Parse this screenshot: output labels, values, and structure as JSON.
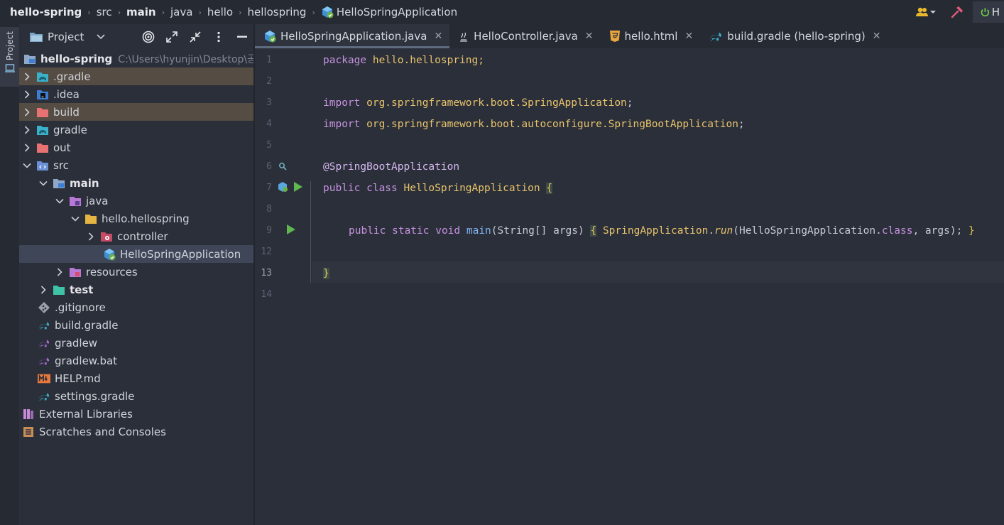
{
  "breadcrumb": [
    {
      "label": "hello-spring",
      "bold": true
    },
    {
      "label": "src",
      "bold": false
    },
    {
      "label": "main",
      "bold": true
    },
    {
      "label": "java",
      "bold": false
    },
    {
      "label": "hello",
      "bold": false
    },
    {
      "label": "hellospring",
      "bold": false
    },
    {
      "label": "HelloSpringApplication",
      "bold": false
    }
  ],
  "run_config_label": "H",
  "strip": {
    "project_label": "Project"
  },
  "project_panel": {
    "title": "Project",
    "root_label": "hello-spring",
    "root_path": "C:\\Users\\hyunjin\\Desktop\\공",
    "tree": [
      {
        "label": ".gradle",
        "level": 0,
        "chevron": "right",
        "icon": "gradle-folder",
        "highlight": true
      },
      {
        "label": ".idea",
        "level": 0,
        "chevron": "right",
        "icon": "idea-folder",
        "highlight": false
      },
      {
        "label": "build",
        "level": 0,
        "chevron": "right",
        "icon": "build-folder",
        "highlight": true
      },
      {
        "label": "gradle",
        "level": 0,
        "chevron": "right",
        "icon": "gradle-folder",
        "highlight": false
      },
      {
        "label": "out",
        "level": 0,
        "chevron": "right",
        "icon": "excluded-folder",
        "highlight": false
      },
      {
        "label": "src",
        "level": 0,
        "chevron": "down",
        "icon": "source-folder",
        "highlight": false
      },
      {
        "label": "main",
        "level": 1,
        "chevron": "down",
        "icon": "module-folder",
        "bold": true
      },
      {
        "label": "java",
        "level": 2,
        "chevron": "down",
        "icon": "java-folder"
      },
      {
        "label": "hello.hellospring",
        "level": 3,
        "chevron": "down",
        "icon": "package-folder"
      },
      {
        "label": "controller",
        "level": 4,
        "chevron": "right",
        "icon": "controller-folder"
      },
      {
        "label": "HelloSpringApplication",
        "level": 5,
        "chevron": "none",
        "icon": "spring-class",
        "selected": true
      },
      {
        "label": "resources",
        "level": 2,
        "chevron": "right",
        "icon": "resources-folder"
      },
      {
        "label": "test",
        "level": 1,
        "chevron": "right",
        "icon": "test-folder",
        "bold": true
      },
      {
        "label": ".gitignore",
        "level": 0,
        "chevron": "none",
        "icon": "git-file"
      },
      {
        "label": "build.gradle",
        "level": 0,
        "chevron": "none",
        "icon": "gradle-file"
      },
      {
        "label": "gradlew",
        "level": 0,
        "chevron": "none",
        "icon": "gradlew-file"
      },
      {
        "label": "gradlew.bat",
        "level": 0,
        "chevron": "none",
        "icon": "gradlew-file"
      },
      {
        "label": "HELP.md",
        "level": 0,
        "chevron": "none",
        "icon": "markdown-file"
      },
      {
        "label": "settings.gradle",
        "level": 0,
        "chevron": "none",
        "icon": "gradle-file"
      }
    ],
    "external_libraries": "External Libraries",
    "scratches": "Scratches and Consoles"
  },
  "tabs": [
    {
      "label": "HelloSpringApplication.java",
      "active": true,
      "icon": "spring-class"
    },
    {
      "label": "HelloController.java",
      "active": false,
      "icon": "java-file"
    },
    {
      "label": "hello.html",
      "active": false,
      "icon": "html-file"
    },
    {
      "label": "build.gradle (hello-spring)",
      "active": false,
      "icon": "gradle-file"
    }
  ],
  "editor": {
    "line_numbers": [
      "1",
      "2",
      "3",
      "4",
      "5",
      "6",
      "7",
      "8",
      "9",
      "12",
      "13",
      "14"
    ],
    "code": {
      "l1_kw": "package",
      "l1_rest": " hello.hellospring;",
      "l3_kw": "import",
      "l3_rest": " org.springframework.boot.",
      "l3_cls": "SpringApplication",
      "l3_end": ";",
      "l4_kw": "import",
      "l4_rest": " org.springframework.boot.autoconfigure.",
      "l4_cls": "SpringBootApplication",
      "l4_end": ";",
      "l6_ann": "@SpringBootApplication",
      "l7_kw": "public class",
      "l7_cls": " HelloSpringApplication ",
      "l7_brace": "{",
      "l9_kw": "public static void",
      "l9_fn": " main",
      "l9_params": "(String[] args",
      "l9_close": ")",
      "l9_sp": " ",
      "l9_brace": "{",
      "l9_cls": " SpringApplication",
      "l9_dot": ".",
      "l9_run": "run",
      "l9_args1": "(HelloSpringApplication.",
      "l9_classkw": "class",
      "l9_args2": ", args); ",
      "l9_end": "}",
      "l13_brace": "}"
    }
  },
  "colors": {
    "background": "#2b2f3a",
    "keyword": "#c692e0",
    "type": "#e7c36b",
    "function": "#7fb3f0",
    "run_green": "#5fb84f",
    "highlight_row": "#554c44",
    "selected_row": "#3e4658"
  }
}
